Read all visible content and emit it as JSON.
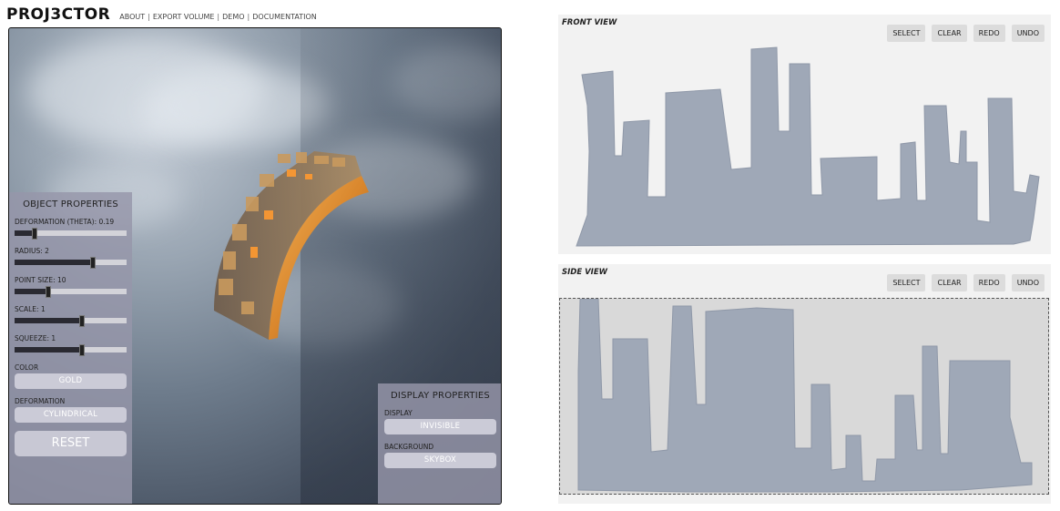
{
  "header": {
    "brand": "PROJ3CTOR",
    "nav": [
      "ABOUT",
      "EXPORT VOLUME",
      "DEMO",
      "DOCUMENTATION"
    ],
    "separator": "|"
  },
  "object_properties": {
    "title": "OBJECT PROPERTIES",
    "sliders": [
      {
        "label": "DEFORMATION (THETA): 0.19",
        "fraction": 0.18
      },
      {
        "label": "RADIUS: 2",
        "fraction": 0.7
      },
      {
        "label": "POINT SIZE: 10",
        "fraction": 0.3
      },
      {
        "label": "SCALE: 1",
        "fraction": 0.6
      },
      {
        "label": "SQUEEZE: 1",
        "fraction": 0.6
      }
    ],
    "color_label": "COLOR",
    "color_value": "GOLD",
    "deformation_label": "DEFORMATION",
    "deformation_value": "CYLINDRICAL",
    "reset": "RESET"
  },
  "display_properties": {
    "title": "DISPLAY PROPERTIES",
    "display_label": "DISPLAY",
    "display_value": "INVISIBLE",
    "background_label": "BACKGROUND",
    "background_value": "SKYBOX"
  },
  "front_view": {
    "title": "FRONT VIEW",
    "buttons": [
      "SELECT",
      "CLEAR",
      "REDO",
      "UNDO"
    ]
  },
  "side_view": {
    "title": "SIDE VIEW",
    "buttons": [
      "SELECT",
      "CLEAR",
      "REDO",
      "UNDO"
    ]
  },
  "colors": {
    "silhouette": "#9fa8b7",
    "object_gold": "#e49a3c"
  }
}
